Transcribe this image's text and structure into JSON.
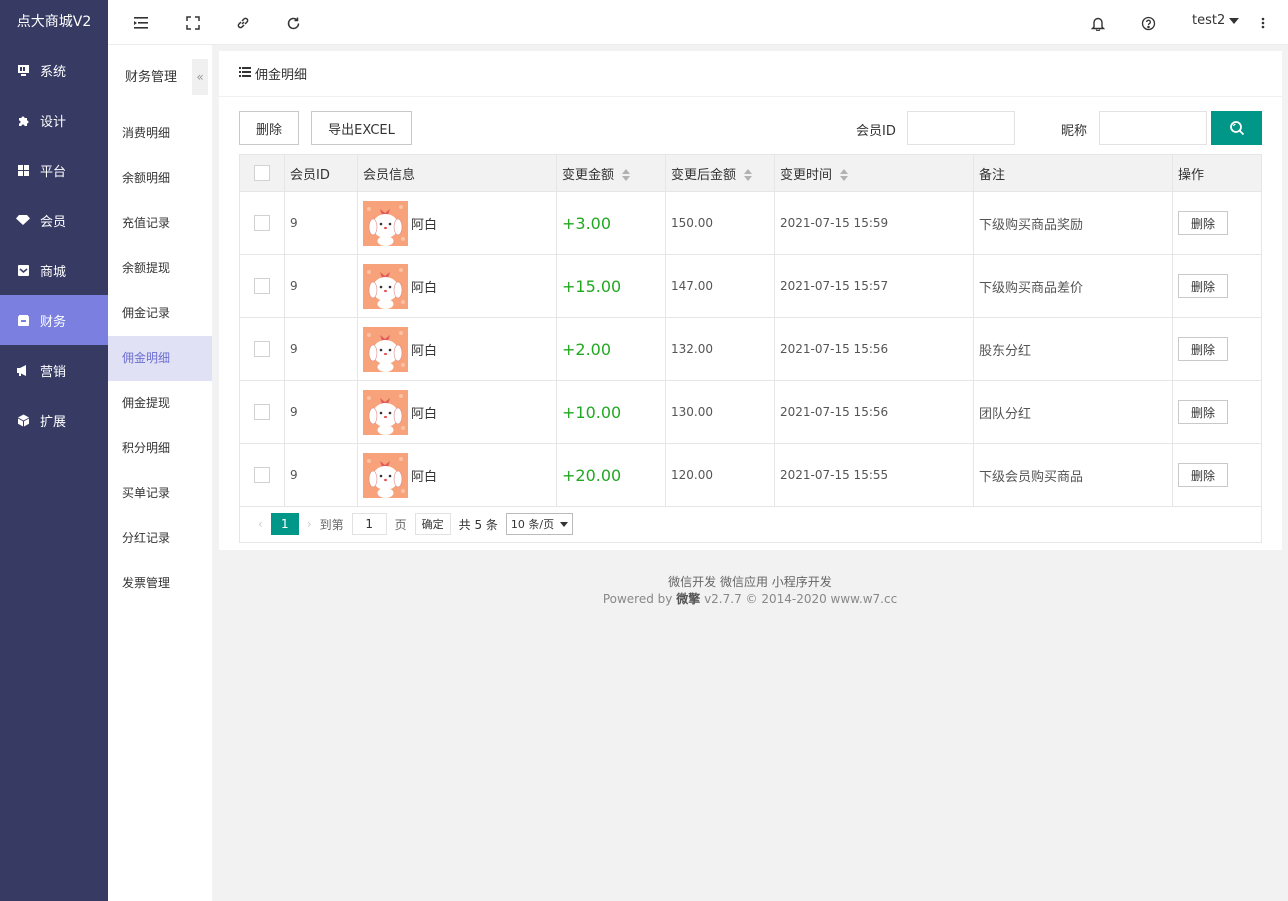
{
  "app": {
    "title": "点大商城V2"
  },
  "sidebar": {
    "items": [
      {
        "label": "系统",
        "icon": "monitor-icon",
        "active": false
      },
      {
        "label": "设计",
        "icon": "puzzle-icon",
        "active": false
      },
      {
        "label": "平台",
        "icon": "grid-icon",
        "active": false
      },
      {
        "label": "会员",
        "icon": "diamond-icon",
        "active": false
      },
      {
        "label": "商城",
        "icon": "inbox-icon",
        "active": false
      },
      {
        "label": "财务",
        "icon": "wallet-icon",
        "active": true
      },
      {
        "label": "营销",
        "icon": "megaphone-icon",
        "active": false
      },
      {
        "label": "扩展",
        "icon": "cube-icon",
        "active": false
      }
    ]
  },
  "topbar": {
    "username": "test2"
  },
  "subnav": {
    "title": "财务管理",
    "collapse": "«",
    "items": [
      "消费明细",
      "余额明细",
      "充值记录",
      "余额提现",
      "佣金记录",
      "佣金明细",
      "佣金提现",
      "积分明细",
      "买单记录",
      "分红记录",
      "发票管理"
    ],
    "active_index": 5
  },
  "card": {
    "title": "佣金明细"
  },
  "toolbar": {
    "delete_label": "删除",
    "export_label": "导出EXCEL",
    "member_id_label": "会员ID",
    "nickname_label": "昵称"
  },
  "table": {
    "headers": {
      "member_id": "会员ID",
      "member_info": "会员信息",
      "change_amount": "变更金额",
      "after_amount": "变更后金额",
      "change_time": "变更时间",
      "remark": "备注",
      "action": "操作"
    },
    "rows": [
      {
        "member_id": "9",
        "name": "阿白",
        "amount": "+3.00",
        "after": "150.00",
        "time": "2021-07-15 15:59",
        "remark": "下级购买商品奖励",
        "action": "删除"
      },
      {
        "member_id": "9",
        "name": "阿白",
        "amount": "+15.00",
        "after": "147.00",
        "time": "2021-07-15 15:57",
        "remark": "下级购买商品差价",
        "action": "删除"
      },
      {
        "member_id": "9",
        "name": "阿白",
        "amount": "+2.00",
        "after": "132.00",
        "time": "2021-07-15 15:56",
        "remark": "股东分红",
        "action": "删除"
      },
      {
        "member_id": "9",
        "name": "阿白",
        "amount": "+10.00",
        "after": "130.00",
        "time": "2021-07-15 15:56",
        "remark": "团队分红",
        "action": "删除"
      },
      {
        "member_id": "9",
        "name": "阿白",
        "amount": "+20.00",
        "after": "120.00",
        "time": "2021-07-15 15:55",
        "remark": "下级会员购买商品",
        "action": "删除"
      }
    ]
  },
  "pager": {
    "prev": "‹",
    "current": "1",
    "next": "›",
    "goto_label": "到第",
    "goto_value": "1",
    "page_unit": "页",
    "confirm": "确定",
    "total": "共 5 条",
    "page_size": "10 条/页"
  },
  "footer": {
    "links": "微信开发 微信应用 小程序开发",
    "powered_prefix": "Powered by",
    "brand": "微擎",
    "powered_suffix": "v2.7.7 © 2014-2020 www.w7.cc"
  },
  "colors": {
    "sidebar_bg": "#373b64",
    "active_nav": "#7b80e0",
    "accent": "#009688",
    "amount": "#21a821"
  }
}
